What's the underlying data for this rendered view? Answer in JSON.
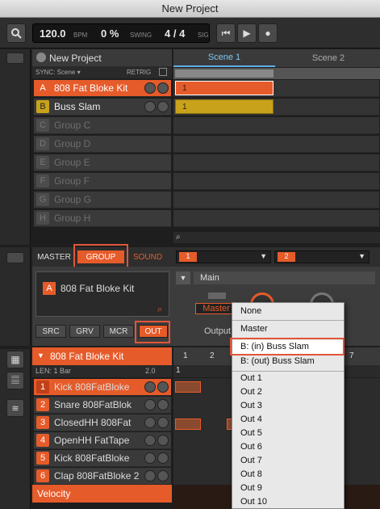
{
  "window": {
    "title": "New Project"
  },
  "transport": {
    "tempo": "120.0",
    "tempo_unit": "BPM",
    "swing": "0 %",
    "swing_label": "SWING",
    "signature": "4 / 4",
    "signature_label": "SIG"
  },
  "arranger": {
    "project_name": "New Project",
    "sync_label": "SYNC: Scene ▾",
    "retrig_label": "RETRIG",
    "scene_tabs": [
      "Scene 1",
      "Scene 2"
    ],
    "groups": [
      {
        "letter": "A",
        "name": "808 Fat Bloke Kit",
        "active": true,
        "clip": "1"
      },
      {
        "letter": "B",
        "name": "Buss Slam",
        "active": true,
        "clip": "1"
      },
      {
        "letter": "C",
        "name": "Group C"
      },
      {
        "letter": "D",
        "name": "Group D"
      },
      {
        "letter": "E",
        "name": "Group E"
      },
      {
        "letter": "F",
        "name": "Group F"
      },
      {
        "letter": "G",
        "name": "Group G"
      },
      {
        "letter": "H",
        "name": "Group H"
      }
    ]
  },
  "control": {
    "tabs": [
      "MASTER",
      "GROUP",
      "SOUND"
    ],
    "page_selectors": [
      "1",
      "2"
    ],
    "group_letter": "A",
    "group_name": "808 Fat Bloke Kit",
    "sub_tabs": [
      "SRC",
      "GRV",
      "MCR",
      "OUT"
    ],
    "section_title": "Main",
    "param_value": "Master",
    "param_label": "Output"
  },
  "pattern": {
    "group_name": "808 Fat Bloke Kit",
    "length_label": "LEN: 1 Bar",
    "zoom_label": "2.0",
    "step_numbers": [
      "1",
      "2",
      "7"
    ],
    "position": "1",
    "pads": [
      {
        "num": "1",
        "name": "Kick 808FatBloke"
      },
      {
        "num": "2",
        "name": "Snare 808FatBlok"
      },
      {
        "num": "3",
        "name": "ClosedHH 808Fat"
      },
      {
        "num": "4",
        "name": "OpenHH FatTape"
      },
      {
        "num": "5",
        "name": "Kick 808FatBloke"
      },
      {
        "num": "6",
        "name": "Clap 808FatBloke 2"
      }
    ],
    "velocity_label": "Velocity"
  },
  "output_menu": {
    "items": [
      {
        "label": "None"
      },
      {
        "label": "Master"
      },
      {
        "label": "B: (in) Buss Slam",
        "highlighted": true
      },
      {
        "label": "B: (out) Buss Slam"
      },
      {
        "label": "Out 1"
      },
      {
        "label": "Out 2"
      },
      {
        "label": "Out 3"
      },
      {
        "label": "Out 4"
      },
      {
        "label": "Out 5"
      },
      {
        "label": "Out 6"
      },
      {
        "label": "Out 7"
      },
      {
        "label": "Out 8"
      },
      {
        "label": "Out 9"
      },
      {
        "label": "Out 10"
      }
    ]
  },
  "colors": {
    "accent": "#e65b2a",
    "group_b": "#c9a21b",
    "highlight_box": "#e2553a"
  }
}
